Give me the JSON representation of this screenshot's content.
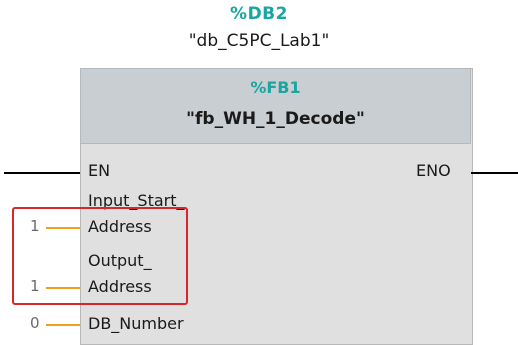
{
  "instance_db": {
    "address": "%DB2",
    "name": "\"db_C5PC_Lab1\""
  },
  "function_block": {
    "address": "%FB1",
    "name": "\"fb_WH_1_Decode\""
  },
  "pins": {
    "en": "EN",
    "eno": "ENO",
    "input_start_line1": "Input_Start_",
    "input_start_line2": "Address",
    "input_start_value": "1",
    "output_line1": "Output_",
    "output_line2": "Address",
    "output_value": "1",
    "db_number": "DB_Number",
    "db_number_value": "0"
  },
  "colors": {
    "address_teal": "#1aa5a0",
    "wire_orange": "#f0a11b",
    "highlight_red": "#d8262d"
  }
}
